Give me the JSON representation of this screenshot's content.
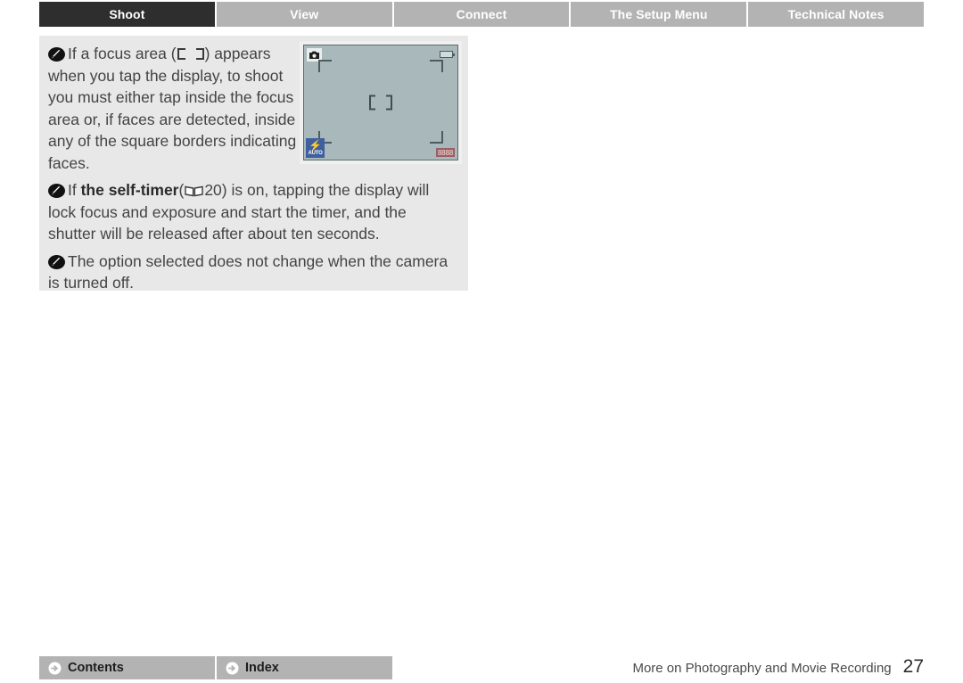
{
  "tabs": [
    {
      "label": "Shoot",
      "active": true
    },
    {
      "label": "View",
      "active": false
    },
    {
      "label": "Connect",
      "active": false
    },
    {
      "label": "The Setup Menu",
      "active": false
    },
    {
      "label": "Technical Notes",
      "active": false
    }
  ],
  "notes": [
    {
      "icon": "note-pencil-icon",
      "text_before_glyph": "If a focus area (",
      "glyph": "focus-area-brackets",
      "text_after_glyph": ") appears when you tap the display, to shoot you must either tap inside the focus area or, if faces are detected, inside any of the square borders indicating faces."
    },
    {
      "icon": "note-pencil-icon",
      "lead": "If ",
      "bold": "the self-timer",
      "paren_open": "(",
      "glyph": "book-reference-icon",
      "page_ref": "20",
      "paren_close": ")",
      "text_after": " is on, tapping the display will lock focus and exposure and start the timer, and the shutter will be released after about ten seconds."
    },
    {
      "icon": "note-pencil-icon",
      "text": "The option selected does not change when the camera is turned off."
    }
  ],
  "lcd": {
    "mode_badge": "scene-mode-camera-icon",
    "battery": "battery-icon",
    "flash_bolt": "⚡",
    "flash_label": "AUTO",
    "frame_counter": "8888",
    "focus_brackets": "center-focus-bracket"
  },
  "footer": {
    "buttons": [
      {
        "label": "Contents",
        "icon": "arrow-right-circle-icon"
      },
      {
        "label": "Index",
        "icon": "arrow-right-circle-icon"
      }
    ],
    "section_title": "More on Photography and Movie Recording",
    "page_number": "27"
  },
  "colors": {
    "active_tab": "#2e2e2e",
    "inactive_tab": "#b3b3b3",
    "panel_bg": "#e8e8e8",
    "lcd_screen": "#a8b8bb",
    "flash_badge": "#3f5f9f",
    "frame_counter": "#9a5f63"
  }
}
